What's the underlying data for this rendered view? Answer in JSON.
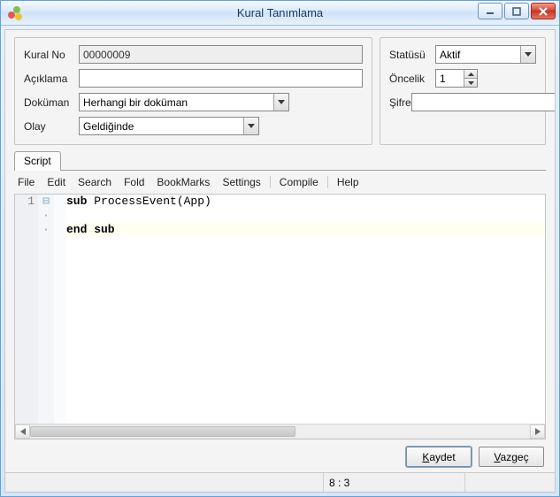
{
  "window": {
    "title": "Kural Tanımlama"
  },
  "left_panel": {
    "kural_no_label": "Kural No",
    "kural_no_value": "00000009",
    "aciklama_label": "Açıklama",
    "aciklama_value": "",
    "dokuman_label": "Doküman",
    "dokuman_value": "Herhangi bir doküman",
    "olay_label": "Olay",
    "olay_value": "Geldiğinde"
  },
  "right_panel": {
    "status_label": "Statüsü",
    "status_value": "Aktif",
    "oncelik_label": "Öncelik",
    "oncelik_value": "1",
    "sifre_label": "Şifre",
    "sifre_value": ""
  },
  "tabs": {
    "script": "Script"
  },
  "editor_menu": {
    "file": "File",
    "edit": "Edit",
    "search": "Search",
    "fold": "Fold",
    "bookmarks": "BookMarks",
    "settings": "Settings",
    "compile": "Compile",
    "help": "Help"
  },
  "code": {
    "ln1": "1",
    "line1_kw1": "sub ",
    "line1_fn": "ProcessEvent(App)",
    "line2": "",
    "line3_kw": "end sub"
  },
  "buttons": {
    "save": "Kaydet",
    "save_underlined": "K",
    "cancel": "Vazgeç",
    "cancel_underlined": "V"
  },
  "status": {
    "pos": "8 : 3"
  }
}
